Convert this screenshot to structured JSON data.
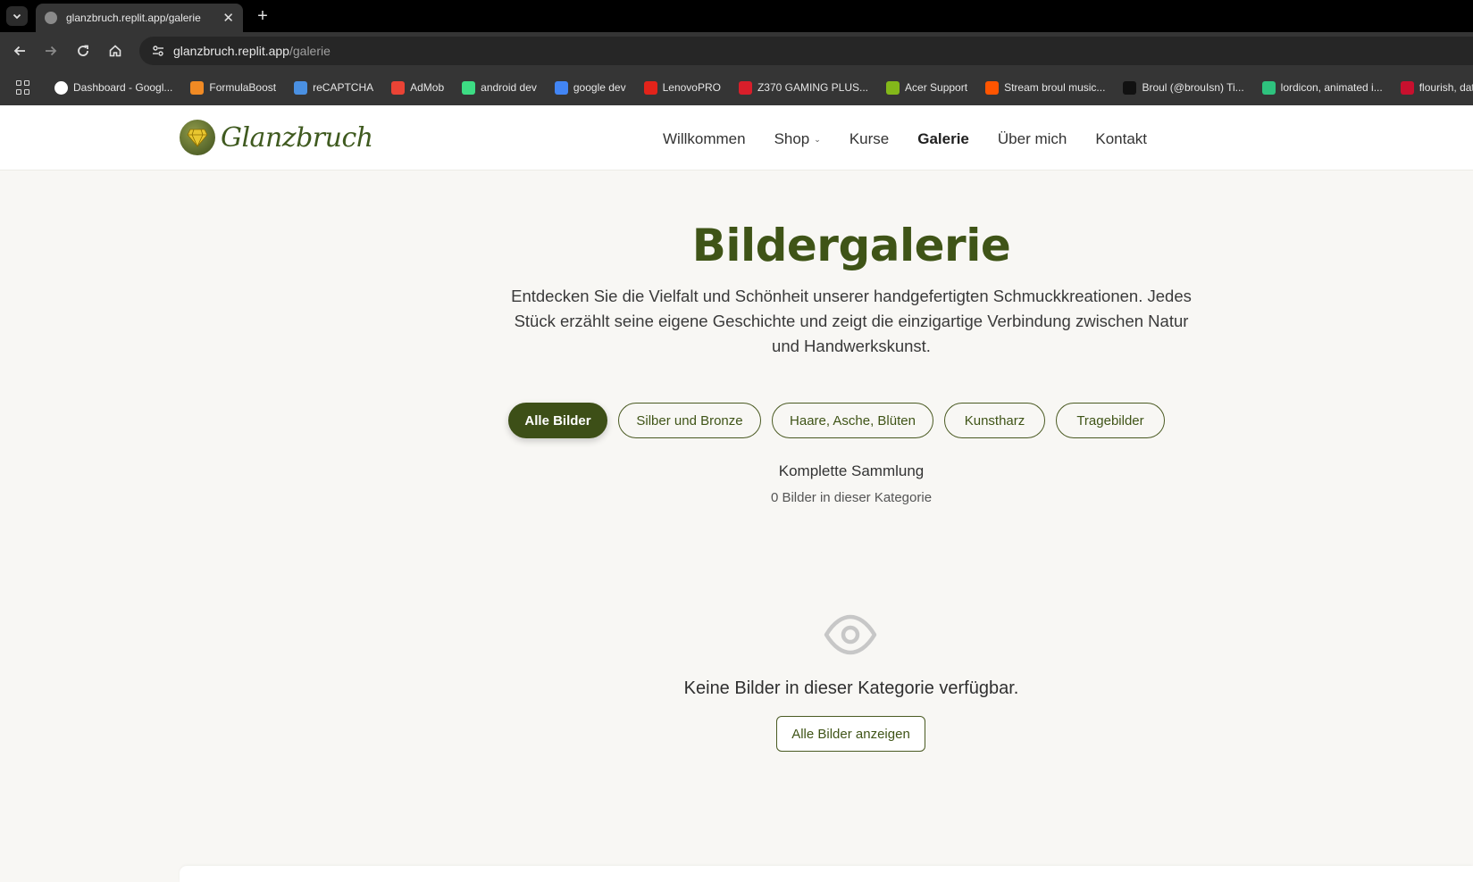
{
  "browser": {
    "tab": {
      "title": "glanzbruch.replit.app/galerie"
    },
    "url": {
      "host": "glanzbruch.replit.app",
      "path": "/galerie"
    },
    "bookmarks": [
      {
        "label": "Dashboard - Googl...",
        "icon": "google-icon",
        "color": "#ffffff"
      },
      {
        "label": "FormulaBoost",
        "icon": "formulaboost-icon",
        "color": "#f08a24"
      },
      {
        "label": "reCAPTCHA",
        "icon": "recaptcha-icon",
        "color": "#4a90e2"
      },
      {
        "label": "AdMob",
        "icon": "admob-icon",
        "color": "#ea4335"
      },
      {
        "label": "android dev",
        "icon": "android-icon",
        "color": "#3ddc84"
      },
      {
        "label": "google dev",
        "icon": "google-dev-icon",
        "color": "#4285f4"
      },
      {
        "label": "LenovoPRO",
        "icon": "lenovo-icon",
        "color": "#e2231a"
      },
      {
        "label": "Z370 GAMING PLUS...",
        "icon": "msi-icon",
        "color": "#d81e2a"
      },
      {
        "label": "Acer Support",
        "icon": "acer-icon",
        "color": "#83b81a"
      },
      {
        "label": "Stream broul music...",
        "icon": "soundcloud-icon",
        "color": "#ff5500"
      },
      {
        "label": "Broul (@brouIsn) Ti...",
        "icon": "tiktok-icon",
        "color": "#111111"
      },
      {
        "label": "lordicon, animated i...",
        "icon": "lordicon-icon",
        "color": "#2ec27e"
      },
      {
        "label": "flourish, data visua...",
        "icon": "flourish-icon",
        "color": "#c8102e"
      }
    ]
  },
  "site": {
    "logo_text": "Glanzbruch",
    "nav": [
      {
        "label": "Willkommen",
        "active": false
      },
      {
        "label": "Shop",
        "active": false,
        "dropdown": true
      },
      {
        "label": "Kurse",
        "active": false
      },
      {
        "label": "Galerie",
        "active": true
      },
      {
        "label": "Über mich",
        "active": false
      },
      {
        "label": "Kontakt",
        "active": false
      }
    ]
  },
  "gallery": {
    "title": "Bildergalerie",
    "intro": "Entdecken Sie die Vielfalt und Schönheit unserer handgefertigten Schmuckkreationen. Jedes Stück erzählt seine eigene Geschichte und zeigt die einzigartige Verbindung zwischen Natur und Handwerkskunst.",
    "filters": [
      {
        "label": "Alle Bilder",
        "active": true
      },
      {
        "label": "Silber und Bronze",
        "active": false
      },
      {
        "label": "Haare, Asche, Blüten",
        "active": false
      },
      {
        "label": "Kunstharz",
        "active": false
      },
      {
        "label": "Tragebilder",
        "active": false
      }
    ],
    "collection_title": "Komplette Sammlung",
    "collection_count": "0 Bilder in dieser Kategorie",
    "empty_message": "Keine Bilder in dieser Kategorie verfügbar.",
    "show_all_label": "Alle Bilder anzeigen"
  },
  "colors": {
    "accent": "#3d4f17",
    "title": "#3f5417",
    "background": "#f8f7f4"
  }
}
